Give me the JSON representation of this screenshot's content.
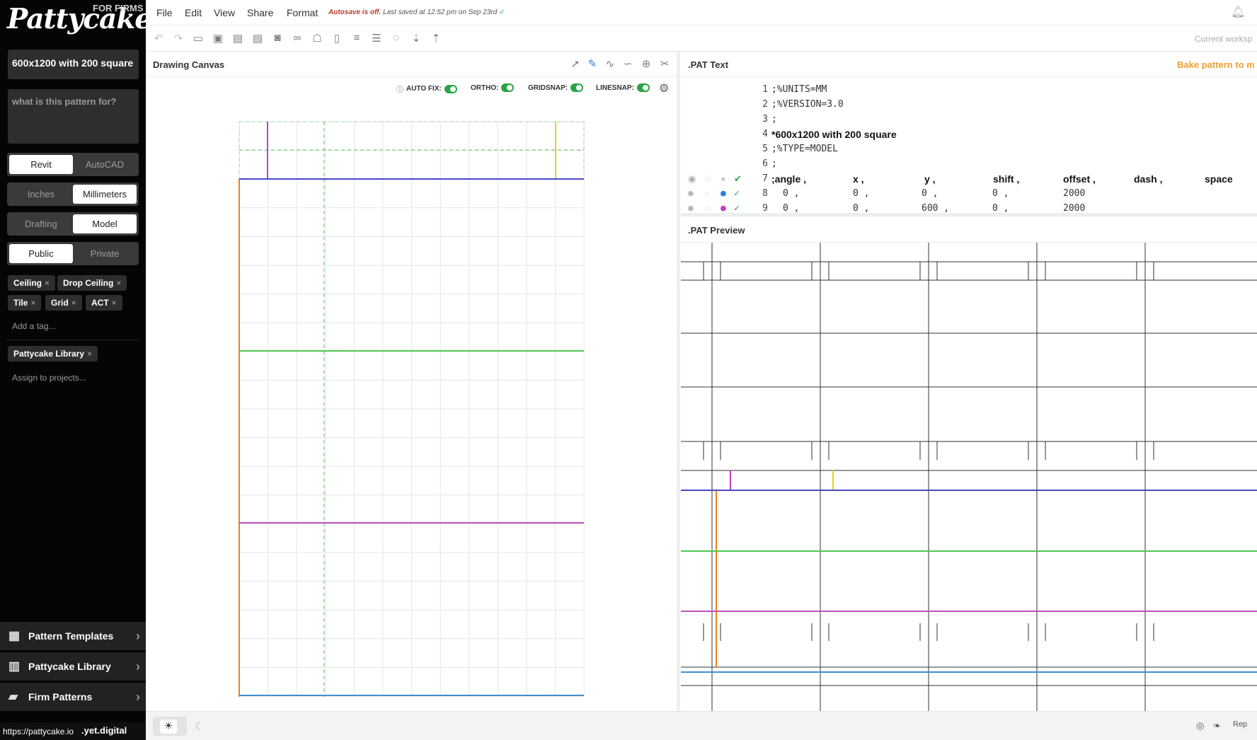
{
  "sidebar": {
    "logo": "Pattycake",
    "badge": "FOR FIRMS",
    "pattern_name": "600x1200 with 200 square",
    "description_placeholder": "what is this pattern for?",
    "software": [
      "Revit",
      "AutoCAD"
    ],
    "software_selected": "Revit",
    "units": [
      "Inches",
      "Millimeters"
    ],
    "units_selected": "Millimeters",
    "pattern_type": [
      "Drafting",
      "Model"
    ],
    "pattern_type_selected": "Model",
    "visibility": [
      "Public",
      "Private"
    ],
    "visibility_selected": "Public",
    "tags": [
      "Ceiling",
      "Drop Ceiling",
      "Tile",
      "Grid",
      "ACT"
    ],
    "add_tag_placeholder": "Add a tag...",
    "projects": [
      "Pattycake Library"
    ],
    "assign_placeholder": "Assign to projects...",
    "nav": [
      {
        "label": "Pattern Templates",
        "icon": "calculator-icon"
      },
      {
        "label": "Pattycake Library",
        "icon": "books-icon"
      },
      {
        "label": "Firm Patterns",
        "icon": "folder-icon"
      }
    ],
    "status_url": "https://pattycake.io",
    "status_tail": ".yet.digital"
  },
  "menu": [
    "File",
    "Edit",
    "View",
    "Share",
    "Format"
  ],
  "autosave": {
    "off": "Autosave is off.",
    "saved": "Last saved at 12:52 pm on Sep 23rd"
  },
  "toolbar": {
    "icons": [
      "undo-icon",
      "redo-icon",
      "open-icon",
      "save-icon",
      "export-icon",
      "import-icon",
      "camera-icon",
      "link-icon",
      "ghost-icon",
      "clipboard-icon",
      "align-left-icon",
      "align-justify-icon",
      "comment-icon",
      "sort-down-icon",
      "sort-up-icon"
    ],
    "workspace": "Current worksp"
  },
  "canvas": {
    "title": "Drawing Canvas",
    "tools": [
      "pointer-icon",
      "pen-icon",
      "polyline-icon",
      "curve-icon",
      "crosshair-icon",
      "scissors-icon"
    ],
    "toggles": [
      {
        "label": "AUTO FIX:",
        "on": true
      },
      {
        "label": "ORTHO:",
        "on": true
      },
      {
        "label": "GRIDSNAP:",
        "on": true
      },
      {
        "label": "LINESNAP:",
        "on": true
      }
    ],
    "colors": {
      "magenta": "#c040c0",
      "yellow": "#e6d020",
      "blue": "#4848c8",
      "orange": "#f08020",
      "green": "#50c850",
      "purple": "#c050c0",
      "lightblue": "#4090d0"
    }
  },
  "pat_text": {
    "title": ".PAT Text",
    "bake_label": "Bake pattern to m",
    "lines": [
      ";%UNITS=MM",
      ";%VERSION=3.0",
      ";",
      "*600x1200 with 200 square",
      ";%TYPE=MODEL",
      ";"
    ],
    "header": [
      ";angle ,",
      "x ,",
      "y ,",
      "shift ,",
      "offset ,",
      "dash ,",
      "space"
    ],
    "rows": [
      {
        "num": "8",
        "angle": "0 ,",
        "x": "0 ,",
        "y": "0 ,",
        "shift": "0 ,",
        "offset": "2000"
      },
      {
        "num": "9",
        "angle": "0 ,",
        "x": "0 ,",
        "y": "600 ,",
        "shift": "0 ,",
        "offset": "2000"
      }
    ]
  },
  "preview": {
    "title": ".PAT Preview"
  },
  "footer": {
    "social": [
      "instagram-icon",
      "twitter-icon"
    ],
    "report": "Rep"
  }
}
